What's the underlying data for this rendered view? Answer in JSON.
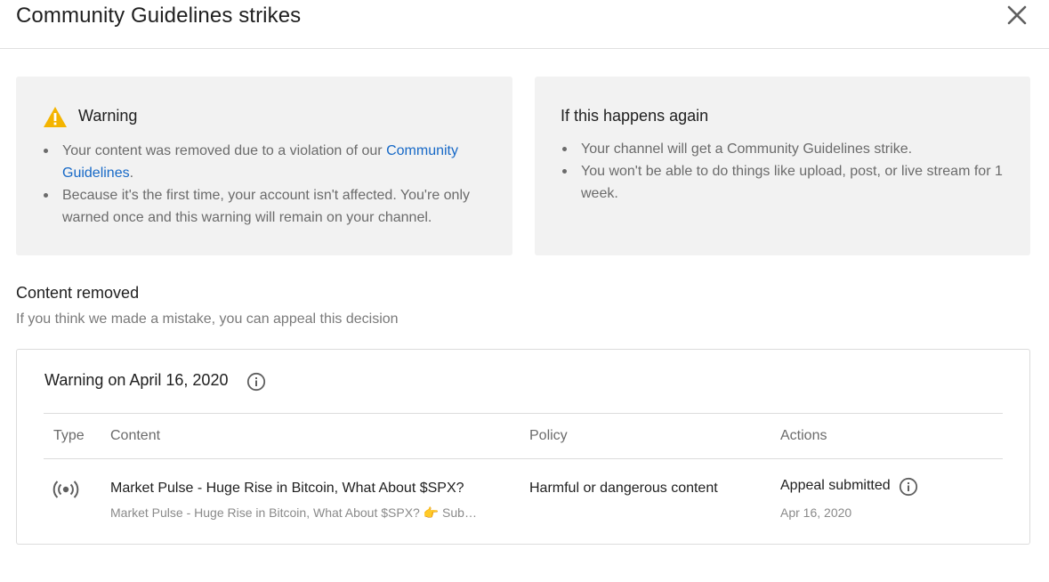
{
  "dialog": {
    "title": "Community Guidelines strikes"
  },
  "warning_card": {
    "heading": "Warning",
    "bullet1_pre": "Your content was removed due to a violation of our ",
    "bullet1_link": "Community Guidelines",
    "bullet1_post": ".",
    "bullet2": "Because it's the first time, your account isn't affected. You're only warned once and this warning will remain on your channel."
  },
  "again_card": {
    "heading": "If this happens again",
    "bullets": [
      "Your channel will get a Community Guidelines strike.",
      "You won't be able to do things like upload, post, or live stream for 1 week."
    ]
  },
  "section": {
    "title": "Content removed",
    "subtitle": "If you think we made a mistake, you can appeal this decision"
  },
  "panel": {
    "title": "Warning on April 16, 2020",
    "columns": [
      "Type",
      "Content",
      "Policy",
      "Actions"
    ],
    "row": {
      "type_icon": "live-stream-icon",
      "content_title": "Market Pulse - Huge Rise in Bitcoin, What About $SPX?",
      "content_desc": "Market Pulse - Huge Rise in Bitcoin, What About $SPX? 👉 Sub…",
      "policy": "Harmful or dangerous content",
      "action_status": "Appeal submitted",
      "action_date": "Apr 16, 2020"
    }
  },
  "colors": {
    "card_bg": "#f2f2f2",
    "link": "#1769c7",
    "warning_icon": "#f4b400"
  }
}
